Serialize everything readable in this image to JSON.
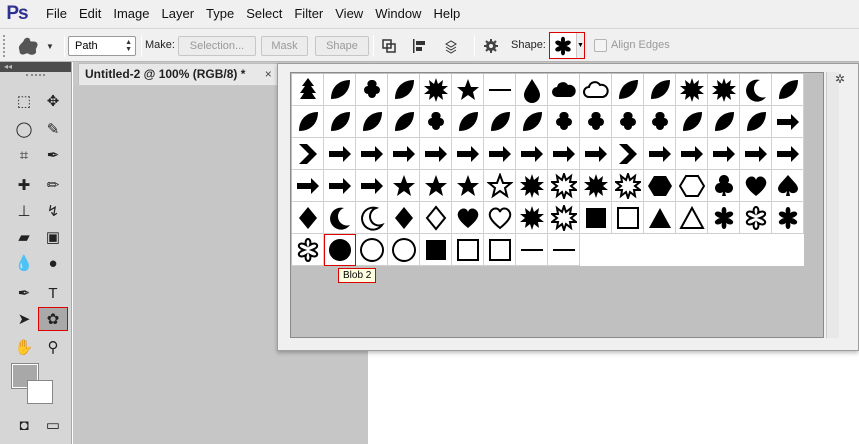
{
  "app": {
    "logo": "Ps"
  },
  "menu": [
    "File",
    "Edit",
    "Image",
    "Layer",
    "Type",
    "Select",
    "Filter",
    "View",
    "Window",
    "Help"
  ],
  "options_bar": {
    "mode_value": "Path",
    "make_label": "Make:",
    "selection_label": "Selection...",
    "mask_label": "Mask",
    "shape_button_label": "Shape",
    "shape_label": "Shape:",
    "align_edges_label": "Align Edges"
  },
  "document": {
    "tab_title": "Untitled-2 @ 100% (RGB/8) *",
    "close_glyph": "×"
  },
  "toolbox": {
    "collapse_glyph": "◂◂"
  },
  "shape_picker": {
    "selected_index": 81,
    "tooltip": "Blob 2",
    "shapes": [
      "tree",
      "grass",
      "leaf-clover",
      "butterfly",
      "sun",
      "starburst",
      "waves",
      "raindrop",
      "cloud",
      "cloud-outline",
      "lightning",
      "fire",
      "snowflake",
      "snowflake-2",
      "moon",
      "leaf-1",
      "leaf-2",
      "leaf-3",
      "leaf-4",
      "maple-leaf",
      "fleur",
      "ivy",
      "fern",
      "ornament",
      "four-leaf",
      "flower-1",
      "flower-2",
      "flower-3",
      "splatter",
      "grass-2",
      "grass-3",
      "arrow-1",
      "chevron",
      "arrow-2",
      "arrow-3",
      "arrow-4",
      "arrow-5",
      "arrow-6",
      "arrow-7",
      "arrow-8",
      "arrow-9",
      "arrow-10",
      "pentagon-arrow",
      "arrow-11",
      "arrow-12",
      "arrow-13",
      "arrow-14",
      "arrow-15",
      "curve-arrow",
      "curve-arrow-2",
      "turn-arrow",
      "starburst-2",
      "starburst-3",
      "star",
      "star-outline",
      "badge",
      "badge-outline",
      "seal",
      "seal-outline",
      "hexagon",
      "hexagon-outline",
      "club",
      "heart",
      "spade",
      "diamond",
      "crescent",
      "crescent-outline",
      "diamond-2",
      "diamond-outline",
      "heart-2",
      "heart-outline",
      "badge-2",
      "badge-2-outline",
      "square-rounded",
      "square-rounded-outline",
      "triangle",
      "triangle-outline",
      "blob-1",
      "blob-1-outline",
      "blob-2",
      "blob-2-outline",
      "circle",
      "circle-ring",
      "circle-outline",
      "square",
      "square-frame",
      "square-outline",
      "film",
      "film-strip"
    ]
  },
  "colors": {
    "accent_red": "#dd0000",
    "ps_blue": "#2e3192",
    "panel_gray": "#f0f0f0"
  }
}
